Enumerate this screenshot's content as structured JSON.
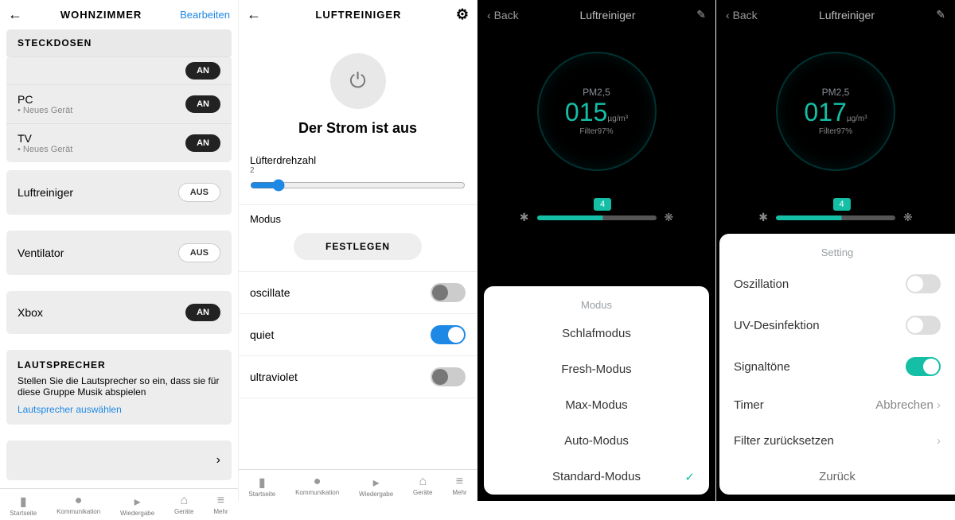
{
  "p1": {
    "title": "WOHNZIMMER",
    "edit": "Bearbeiten",
    "section_sockets": "STECKDOSEN",
    "on": "AN",
    "off": "AUS",
    "new_device": "• Neues Gerät",
    "devices": {
      "pc": "PC",
      "tv": "TV",
      "luft": "Luftreiniger",
      "vent": "Ventilator",
      "xbox": "Xbox"
    },
    "speaker_h": "LAUTSPRECHER",
    "speaker_txt": "Stellen Sie die Lautsprecher so ein, dass sie für diese Gruppe Musik abspielen",
    "speaker_link": "Lautsprecher auswählen",
    "tabs": [
      "Startseite",
      "Kommunikation",
      "Wiedergabe",
      "Geräte",
      "Mehr"
    ]
  },
  "p2": {
    "title": "LUFTREINIGER",
    "power_text": "Der Strom ist aus",
    "fan_label": "Lüfterdrehzahl",
    "fan_value": "2",
    "mode_label": "Modus",
    "mode_btn": "FESTLEGEN",
    "t_oscillate": "oscillate",
    "t_quiet": "quiet",
    "t_uv": "ultraviolet"
  },
  "dk": {
    "back": "Back",
    "title": "Luftreiniger",
    "pm_label": "PM2,5",
    "pm_unit": "µg/m³",
    "filter": "Filter97%",
    "fan_level": "4"
  },
  "p3": {
    "pm_value": "015",
    "sheet_title": "Modus",
    "modes": [
      "Schlafmodus",
      "Fresh-Modus",
      "Max-Modus",
      "Auto-Modus",
      "Standard-Modus"
    ]
  },
  "p4": {
    "pm_value": "017",
    "sheet_title": "Setting",
    "osc": "Oszillation",
    "uv": "UV-Desinfektion",
    "beep": "Signaltöne",
    "timer": "Timer",
    "timer_val": "Abbrechen",
    "filter_reset": "Filter zurücksetzen",
    "back": "Zurück"
  }
}
